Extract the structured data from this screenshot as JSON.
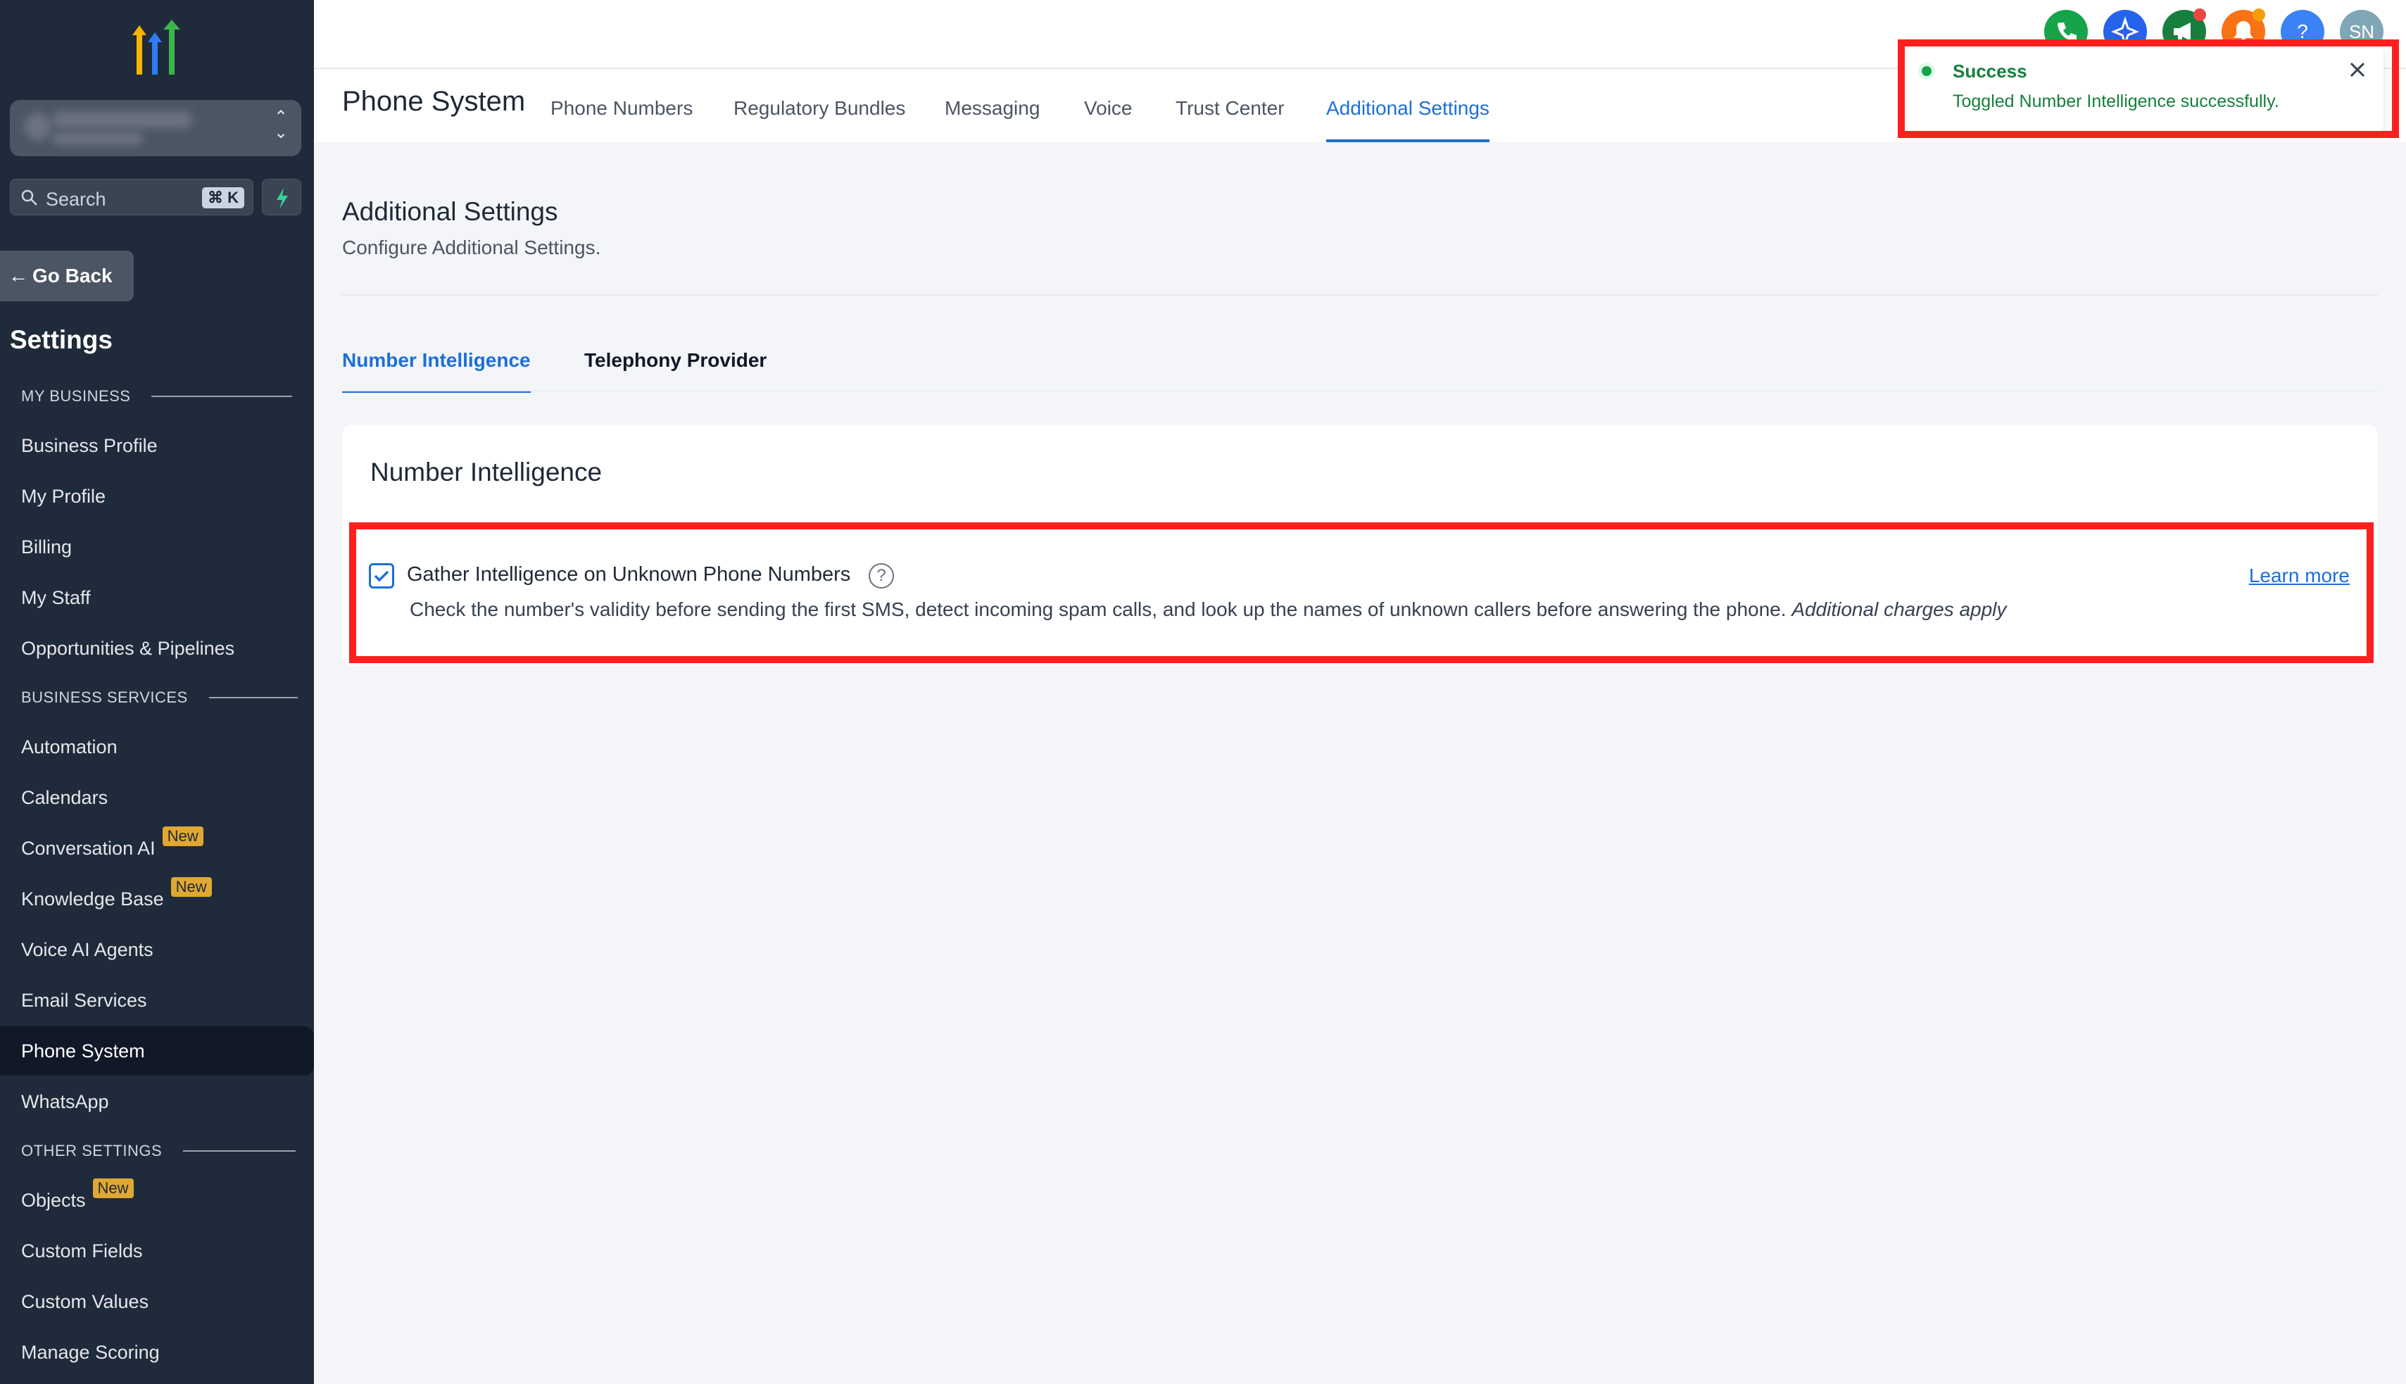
{
  "sidebar": {
    "search_placeholder": "Search",
    "search_shortcut": "⌘ K",
    "go_back": "Go Back",
    "title": "Settings",
    "sections": {
      "my_business": "MY BUSINESS",
      "business_services": "BUSINESS SERVICES",
      "other_settings": "OTHER SETTINGS"
    },
    "items": {
      "business_profile": "Business Profile",
      "my_profile": "My Profile",
      "billing": "Billing",
      "my_staff": "My Staff",
      "opportunities": "Opportunities & Pipelines",
      "automation": "Automation",
      "calendars": "Calendars",
      "conversation_ai": "Conversation AI",
      "knowledge_base": "Knowledge Base",
      "voice_ai_agents": "Voice AI Agents",
      "email_services": "Email Services",
      "phone_system": "Phone System",
      "whatsapp": "WhatsApp",
      "objects": "Objects",
      "custom_fields": "Custom Fields",
      "custom_values": "Custom Values",
      "manage_scoring": "Manage Scoring"
    },
    "badge_new": "New",
    "active_item": "Phone System"
  },
  "topbar": {
    "avatar_initials": "SN",
    "help_label": "?",
    "colors": {
      "phone": "#16a34a",
      "ai": "#2563eb",
      "announce": "#15803d",
      "bell": "#f97316",
      "help": "#3b82f6",
      "avatar": "#7fa7b5"
    }
  },
  "subnav": {
    "page_title": "Phone System",
    "tabs": {
      "phone_numbers": "Phone Numbers",
      "regulatory_bundles": "Regulatory Bundles",
      "messaging": "Messaging",
      "voice": "Voice",
      "trust_center": "Trust Center",
      "additional_settings": "Additional Settings"
    },
    "active_tab": "Additional Settings"
  },
  "main": {
    "title": "Additional Settings",
    "subtitle": "Configure Additional Settings.",
    "inner_tabs": {
      "number_intelligence": "Number Intelligence",
      "telephony_provider": "Telephony Provider"
    },
    "active_inner_tab": "Number Intelligence",
    "card": {
      "title": "Number Intelligence",
      "option_label": "Gather Intelligence on Unknown Phone Numbers",
      "option_checked": true,
      "option_desc": "Check the number's validity before sending the first SMS, detect incoming spam calls, and look up the names of unknown callers before answering the phone.",
      "option_desc_italic": "Additional charges apply",
      "learn_more": "Learn more"
    }
  },
  "toast": {
    "title": "Success",
    "message": "Toggled Number Intelligence successfully."
  },
  "colors": {
    "accent": "#1d6fd6",
    "sidebar_bg": "#1f2a3a",
    "highlight": "#ff1f1f",
    "badge": "#e0a832",
    "success": "#15803d"
  }
}
